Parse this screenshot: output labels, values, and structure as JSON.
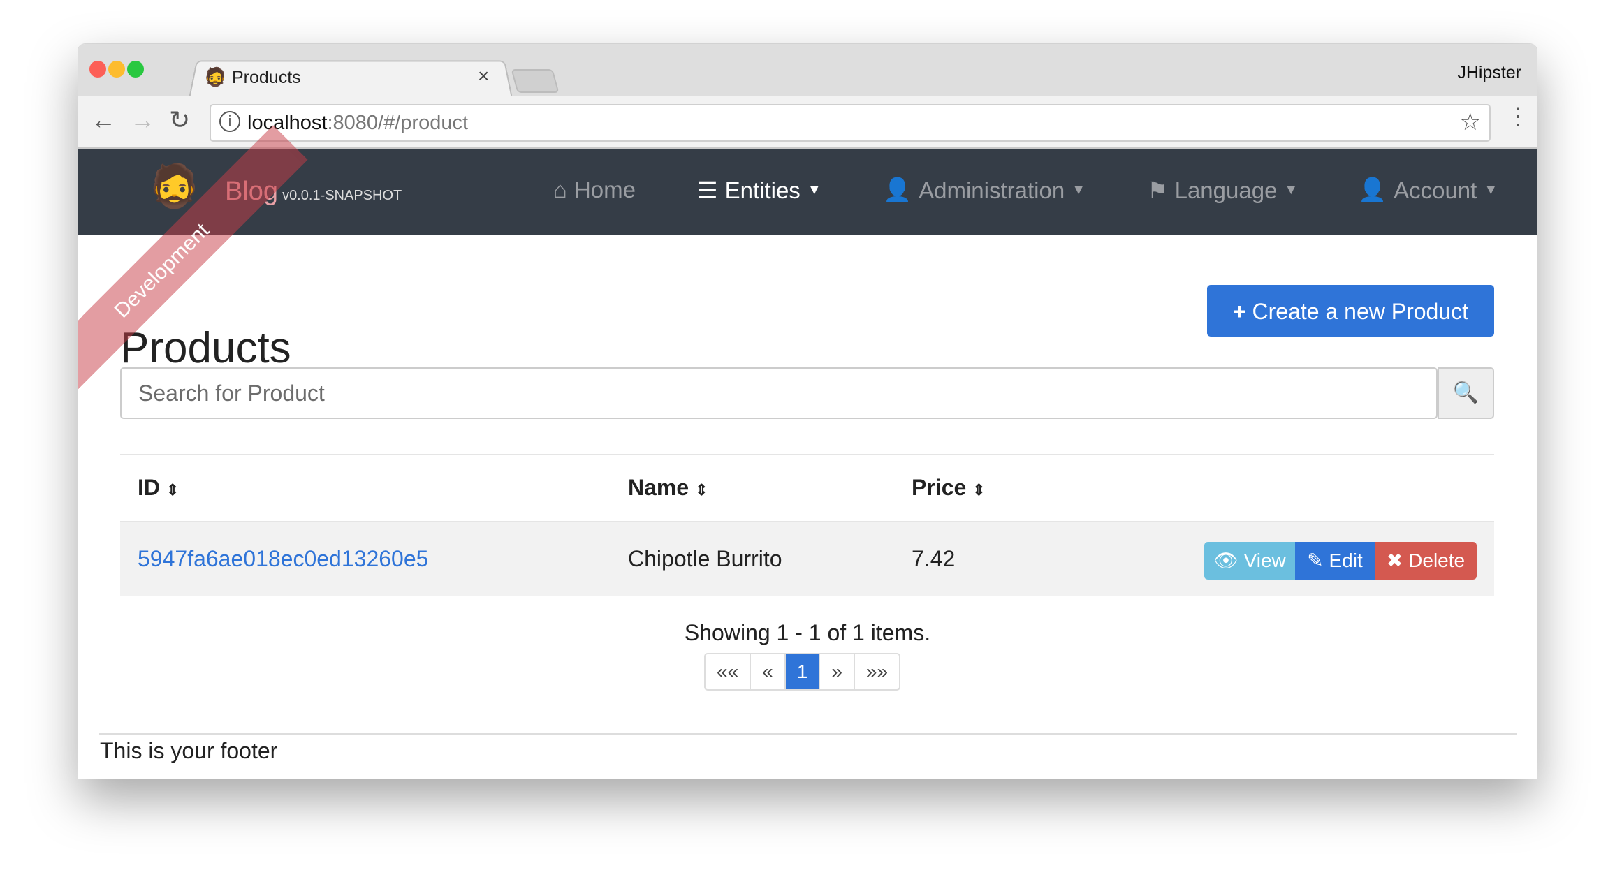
{
  "browser": {
    "tab_title": "Products",
    "tab_close": "×",
    "profile": "JHipster",
    "url_host": "localhost",
    "url_rest": ":8080/#/product"
  },
  "navbar": {
    "brand": "Blog",
    "version": "v0.0.1-SNAPSHOT",
    "ribbon": "Development",
    "items": [
      {
        "label": "Home",
        "icon": "home-icon"
      },
      {
        "label": "Entities",
        "icon": "list-icon"
      },
      {
        "label": "Administration",
        "icon": "user-plus-icon"
      },
      {
        "label": "Language",
        "icon": "flag-icon"
      },
      {
        "label": "Account",
        "icon": "user-icon"
      }
    ]
  },
  "page": {
    "title": "Products",
    "create_label": "Create a new Product",
    "search_placeholder": "Search for Product"
  },
  "table": {
    "headers": [
      "ID",
      "Name",
      "Price"
    ],
    "rows": [
      {
        "id": "5947fa6ae018ec0ed13260e5",
        "name": "Chipotle Burrito",
        "price": "7.42"
      }
    ],
    "actions": {
      "view": "View",
      "edit": "Edit",
      "delete": "Delete"
    }
  },
  "pagination": {
    "summary": "Showing 1 - 1 of 1 items.",
    "first": "««",
    "prev": "«",
    "current": "1",
    "next": "»",
    "last": "»»"
  },
  "footer": {
    "text": "This is your footer"
  },
  "colors": {
    "primary": "#2f74d8",
    "info": "#6bbfdf",
    "danger": "#d45950",
    "navbar": "#353d47"
  }
}
